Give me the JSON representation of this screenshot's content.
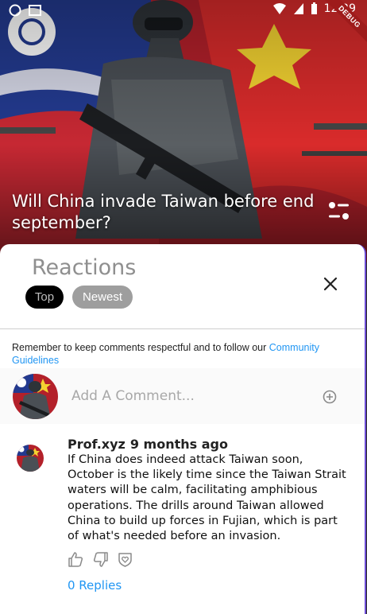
{
  "status_bar": {
    "time": "12:29"
  },
  "debug_banner": "DEBUG",
  "article": {
    "title": "Will China invade Taiwan before end september?",
    "icons": {
      "filter": "filter-sliders-icon"
    }
  },
  "reactions": {
    "title": "Reactions",
    "tabs": [
      {
        "label": "Top",
        "selected": true
      },
      {
        "label": "Newest",
        "selected": false
      }
    ],
    "close_icon": "close-icon"
  },
  "guidelines": {
    "text": "Remember to keep comments respectful and to follow our ",
    "link": "Community Guidelines"
  },
  "composer": {
    "placeholder": "Add A Comment...",
    "add_icon": "add-circle-icon"
  },
  "comments": [
    {
      "author": "Prof.xyz",
      "time": "9 months ago",
      "text": "If China does indeed attack Taiwan soon, October is the likely time since the Taiwan Strait waters will be calm, facilitating amphibious operations. The drills around Taiwan allowed China to build up forces in Fujian, which is part of what's needed before an invasion.",
      "actions": [
        "thumbs-up-icon",
        "thumbs-down-icon",
        "heart-shield-icon"
      ],
      "replies_label": "0 Replies"
    }
  ],
  "colors": {
    "link": "#2196f3",
    "chip_selected_bg": "#000000",
    "chip_unselected_bg": "#9e9e9e",
    "debug": "#9e1b1b"
  }
}
